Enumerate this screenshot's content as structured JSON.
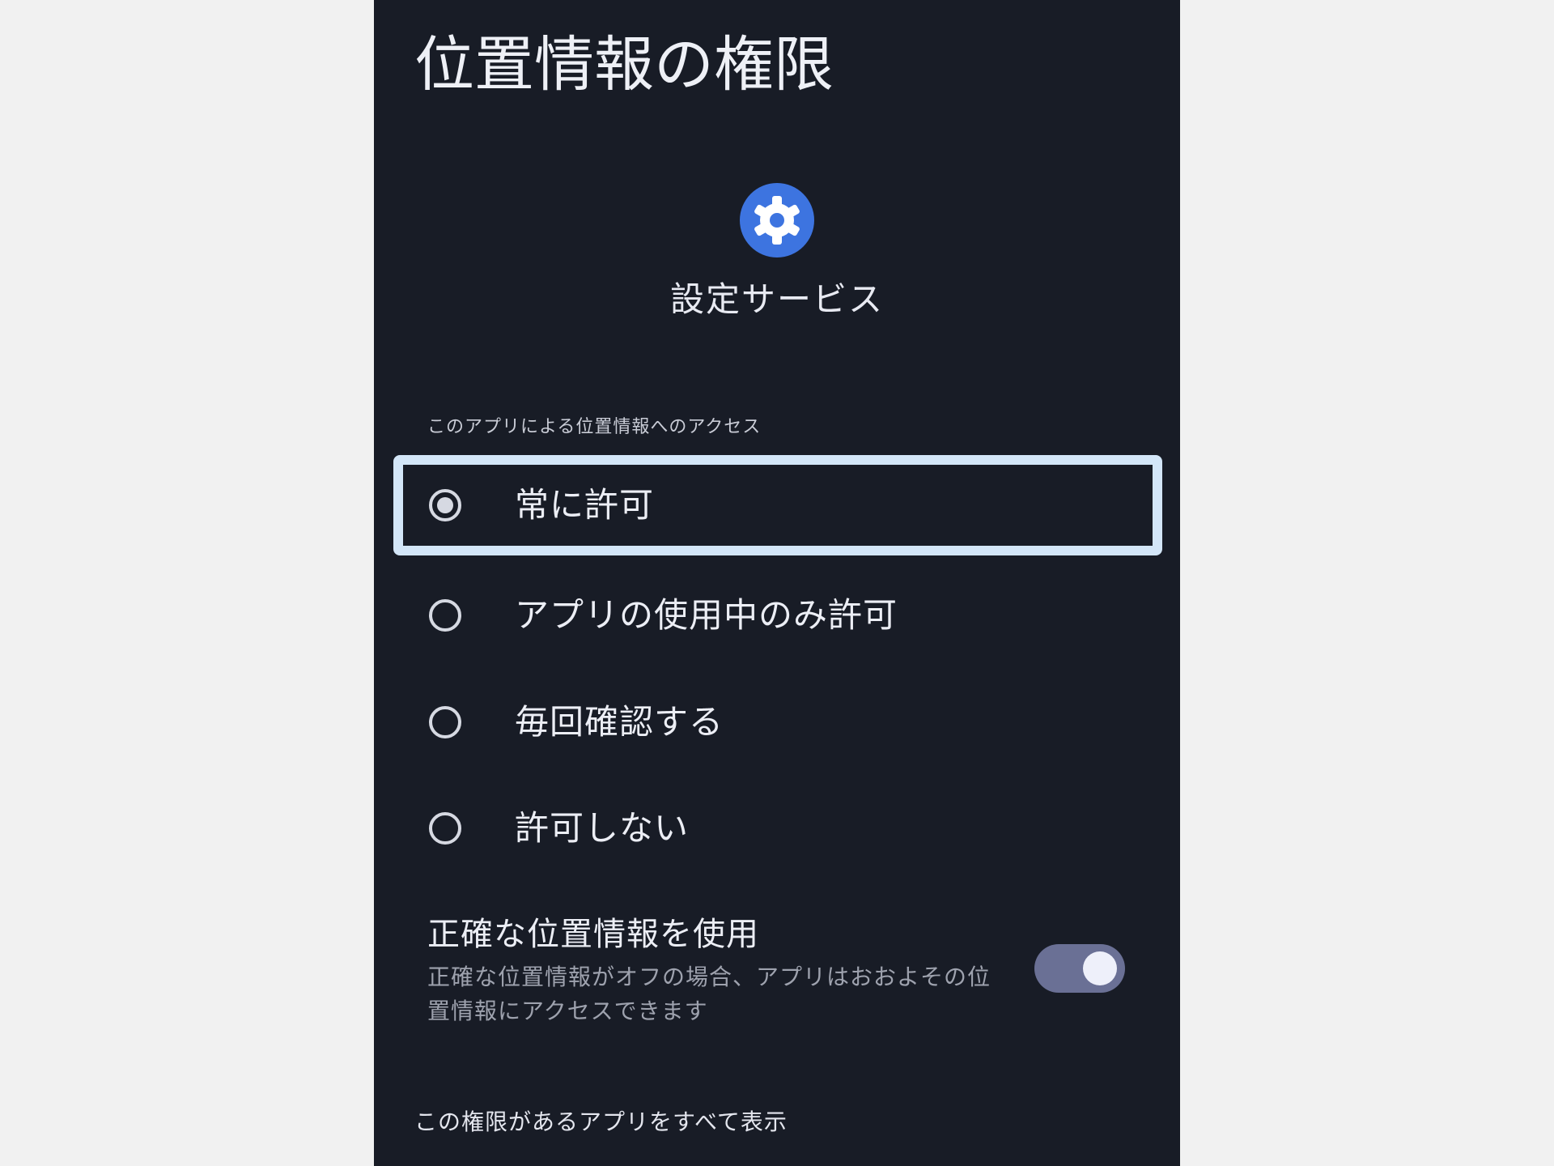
{
  "page": {
    "title": "位置情報の権限"
  },
  "app": {
    "icon": "gear-icon",
    "name": "設定サービス",
    "icon_color": "#3d74e0"
  },
  "location_access": {
    "header": "このアプリによる位置情報へのアクセス",
    "selected_index": 0,
    "options": [
      {
        "label": "常に許可",
        "selected": true
      },
      {
        "label": "アプリの使用中のみ許可",
        "selected": false
      },
      {
        "label": "毎回確認する",
        "selected": false
      },
      {
        "label": "許可しない",
        "selected": false
      }
    ]
  },
  "precise_location": {
    "title": "正確な位置情報を使用",
    "description": "正確な位置情報がオフの場合、アプリはおおよその位置情報にアクセスできます",
    "enabled": true
  },
  "footer": {
    "view_all_label": "この権限があるアプリをすべて表示"
  },
  "colors": {
    "background": "#181c26",
    "focus_ring": "#d3e6f8",
    "toggle_track": "#6a7095",
    "toggle_thumb": "#eef0fa"
  }
}
